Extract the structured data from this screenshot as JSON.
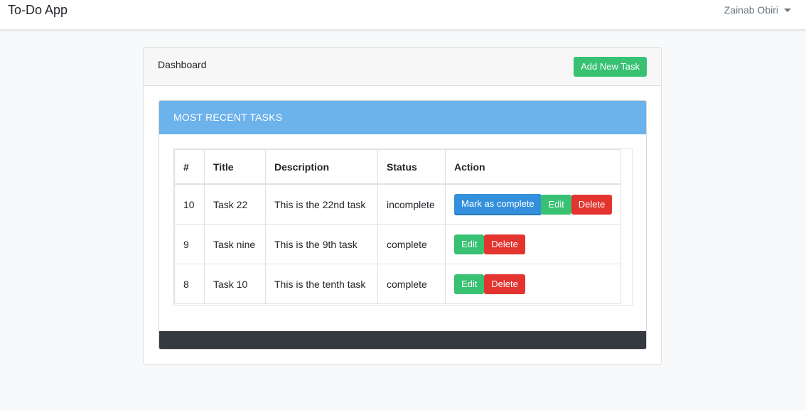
{
  "navbar": {
    "brand": "To-Do App",
    "user": "Zainab Obiri"
  },
  "dashboard": {
    "title": "Dashboard",
    "add_button": "Add New Task",
    "panel_title": "MOST RECENT TASKS"
  },
  "table": {
    "headers": [
      "#",
      "Title",
      "Description",
      "Status",
      "Action"
    ],
    "rows": [
      {
        "id": "10",
        "title": "Task 22",
        "description": "This is the 22nd task",
        "status": "incomplete",
        "actions": {
          "complete": "Mark as complete",
          "edit": "Edit",
          "delete": "Delete"
        }
      },
      {
        "id": "9",
        "title": "Task nine",
        "description": "This is the 9th task",
        "status": "complete",
        "actions": {
          "edit": "Edit",
          "delete": "Delete"
        }
      },
      {
        "id": "8",
        "title": "Task 10",
        "description": "This is the tenth task",
        "status": "complete",
        "actions": {
          "edit": "Edit",
          "delete": "Delete"
        }
      }
    ]
  },
  "colors": {
    "success": "#38c172",
    "danger": "#e3342f",
    "primary": "#3490dc",
    "panel_header": "#6cb2eb",
    "footer": "#343a40"
  }
}
